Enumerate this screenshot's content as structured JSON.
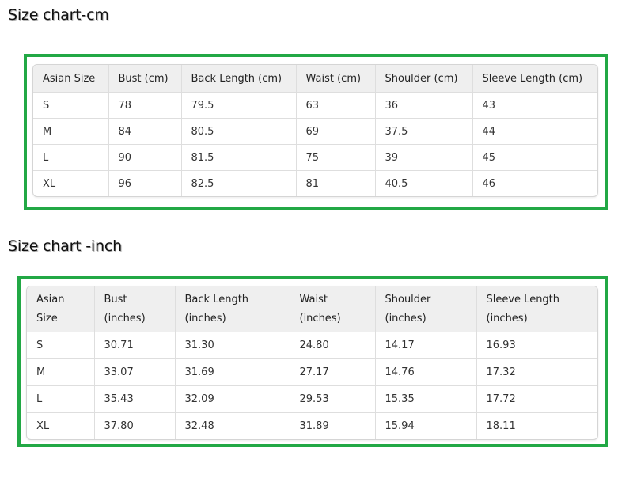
{
  "cm_chart": {
    "title": "Size chart-cm",
    "headers": [
      "Asian Size",
      "Bust (cm)",
      "Back Length (cm)",
      "Waist (cm)",
      "Shoulder (cm)",
      "Sleeve Length (cm)"
    ],
    "rows": [
      [
        "S",
        "78",
        "79.5",
        "63",
        "36",
        "43"
      ],
      [
        "M",
        "84",
        "80.5",
        "69",
        "37.5",
        "44"
      ],
      [
        "L",
        "90",
        "81.5",
        "75",
        "39",
        "45"
      ],
      [
        "XL",
        "96",
        "82.5",
        "81",
        "40.5",
        "46"
      ]
    ]
  },
  "inch_chart": {
    "title": "Size chart -inch",
    "headers": [
      [
        "Asian",
        "Size"
      ],
      [
        "Bust",
        "(inches)"
      ],
      [
        "Back Length",
        "(inches)"
      ],
      [
        "Waist",
        "(inches)"
      ],
      [
        "Shoulder",
        "(inches)"
      ],
      [
        "Sleeve Length",
        "(inches)"
      ]
    ],
    "rows": [
      [
        "S",
        "30.71",
        "31.30",
        "24.80",
        "14.17",
        "16.93"
      ],
      [
        "M",
        "33.07",
        "31.69",
        "27.17",
        "14.76",
        "17.32"
      ],
      [
        "L",
        "35.43",
        "32.09",
        "29.53",
        "15.35",
        "17.72"
      ],
      [
        "XL",
        "37.80",
        "32.48",
        "31.89",
        "15.94",
        "18.11"
      ]
    ]
  },
  "colors": {
    "frame": "#22a845",
    "header_bg": "#efefef"
  }
}
